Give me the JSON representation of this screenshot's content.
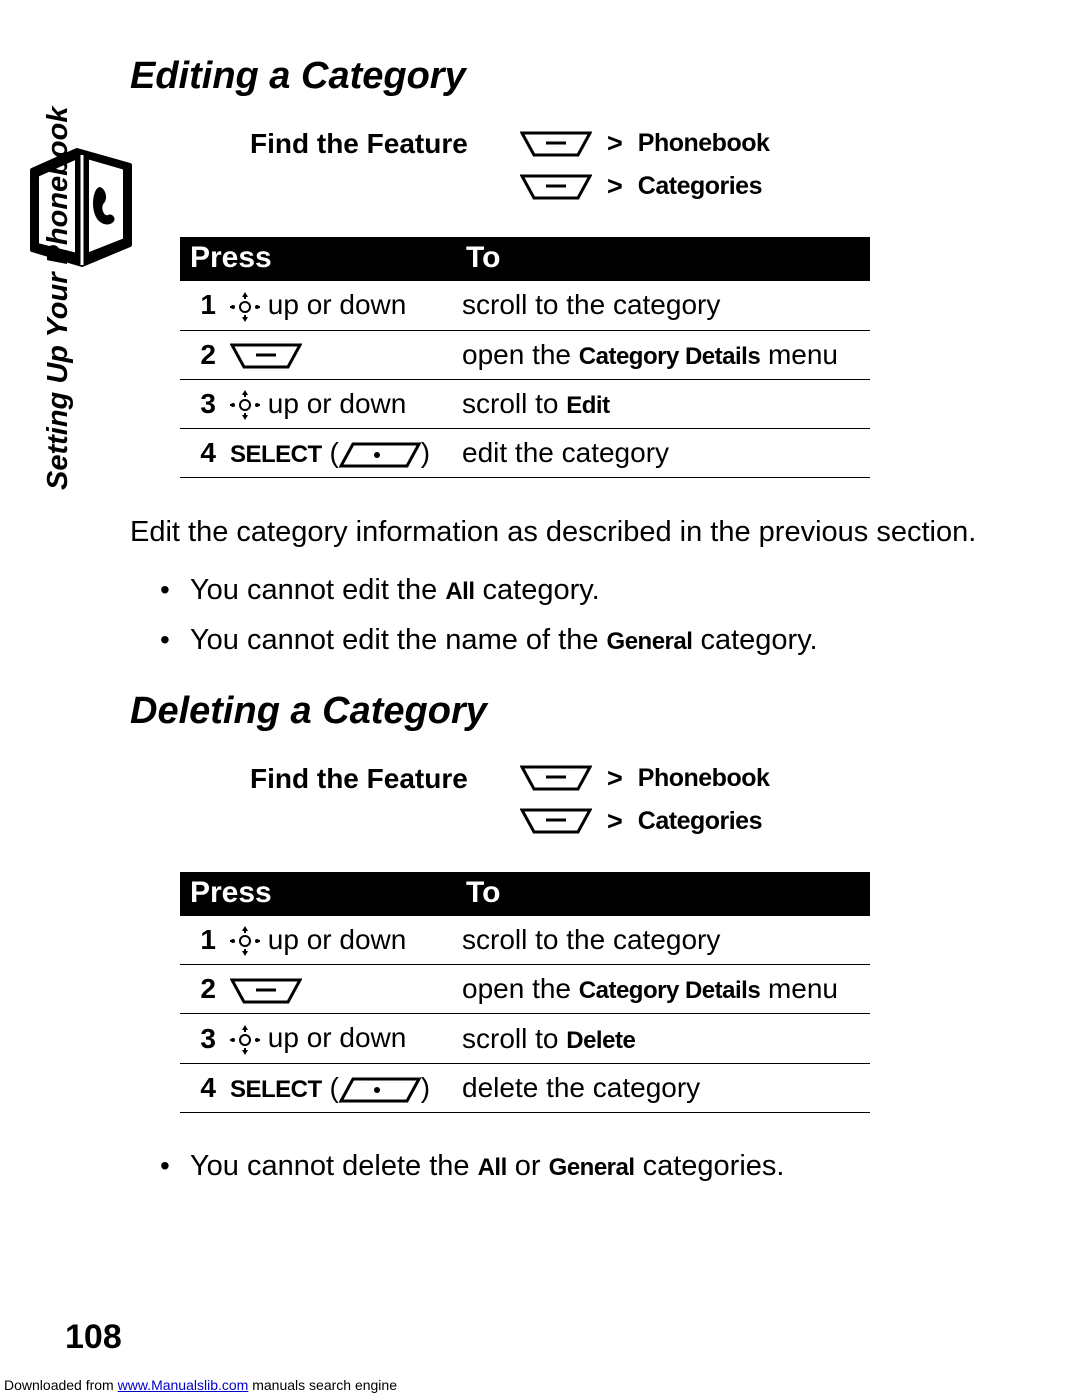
{
  "sideLabel": "Setting Up Your Phonebook",
  "pageNumber": "108",
  "footer": {
    "prefix": "Downloaded from ",
    "link": "www.Manualslib.com",
    "suffix": " manuals search engine"
  },
  "section1": {
    "title": "Editing a Category",
    "featureLabel": "Find the Feature",
    "nav1": "Phonebook",
    "nav2": "Categories",
    "tableHeader": {
      "press": "Press",
      "to": "To"
    },
    "rows": [
      {
        "num": "1",
        "press_suffix": " up or down",
        "to_before": "scroll to the category",
        "to_bold": "",
        "to_after": ""
      },
      {
        "num": "2",
        "press_suffix": "",
        "to_before": "open the ",
        "to_bold": "Category Details",
        "to_after": " menu"
      },
      {
        "num": "3",
        "press_suffix": " up or down",
        "to_before": "scroll to ",
        "to_bold": "Edit",
        "to_after": ""
      },
      {
        "num": "4",
        "select": "SELECT",
        "to_before": "edit the category",
        "to_bold": "",
        "to_after": ""
      }
    ],
    "bodyText": "Edit the category information as described in the previous section.",
    "bullets": [
      {
        "before": "You cannot edit the ",
        "bold": "All",
        "after": " category."
      },
      {
        "before": "You cannot edit the name of the ",
        "bold": "General",
        "after": " category."
      }
    ]
  },
  "section2": {
    "title": "Deleting a Category",
    "featureLabel": "Find the Feature",
    "nav1": "Phonebook",
    "nav2": "Categories",
    "tableHeader": {
      "press": "Press",
      "to": "To"
    },
    "rows": [
      {
        "num": "1",
        "press_suffix": " up or down",
        "to_before": "scroll to the category",
        "to_bold": "",
        "to_after": ""
      },
      {
        "num": "2",
        "press_suffix": "",
        "to_before": "open the ",
        "to_bold": "Category Details",
        "to_after": " menu"
      },
      {
        "num": "3",
        "press_suffix": " up or down",
        "to_before": "scroll to ",
        "to_bold": "Delete",
        "to_after": ""
      },
      {
        "num": "4",
        "select": "SELECT",
        "to_before": "delete the category",
        "to_bold": "",
        "to_after": ""
      }
    ],
    "bullets": [
      {
        "before": "You cannot delete the ",
        "bold": "All",
        "mid": " or ",
        "bold2": "General",
        "after": " categories."
      }
    ]
  }
}
